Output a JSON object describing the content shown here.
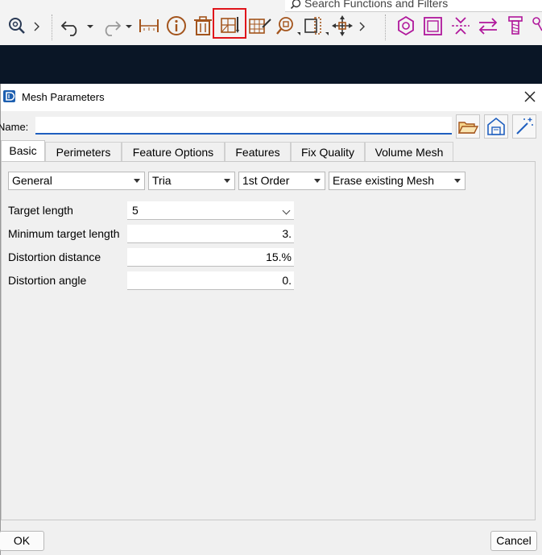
{
  "toolbar": {
    "search_placeholder": "Search Functions and Filters",
    "highlight_color": "#e0141b"
  },
  "dialog": {
    "title": "Mesh Parameters",
    "name_label": "Name:",
    "name_value": "",
    "tabs": [
      {
        "label": "Basic",
        "active": true
      },
      {
        "label": "Perimeters"
      },
      {
        "label": "Feature Options"
      },
      {
        "label": "Features"
      },
      {
        "label": "Fix Quality"
      },
      {
        "label": "Volume Mesh"
      }
    ],
    "selectors": {
      "category": "General",
      "element_type": "Tria",
      "order": "1st Order",
      "existing_mesh": "Erase existing Mesh"
    },
    "params": [
      {
        "label": "Target length",
        "value": "5"
      },
      {
        "label": "Minimum target length",
        "value": "3."
      },
      {
        "label": "Distortion distance",
        "value": "15.%"
      },
      {
        "label": "Distortion angle",
        "value": "0."
      }
    ],
    "ok_label": "OK",
    "cancel_label": "Cancel"
  }
}
